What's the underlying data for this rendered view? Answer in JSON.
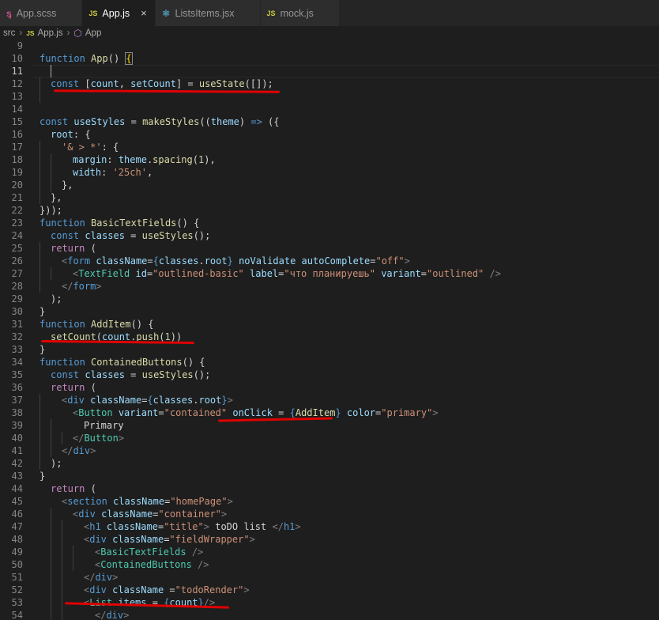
{
  "tabs": [
    {
      "label": "App.scss",
      "icon": "scss-icon",
      "active": false
    },
    {
      "label": "App.js",
      "icon": "js-icon",
      "active": true,
      "close": "×"
    },
    {
      "label": "ListsItems.jsx",
      "icon": "react-icon",
      "active": false
    },
    {
      "label": "mock.js",
      "icon": "js-icon",
      "active": false
    }
  ],
  "breadcrumb": {
    "folder": "src",
    "file": "App.js",
    "symbol": "App",
    "js_badge": "JS"
  },
  "line_numbers": [
    "9",
    "10",
    "11",
    "12",
    "13",
    "14",
    "15",
    "16",
    "17",
    "18",
    "19",
    "20",
    "21",
    "22",
    "23",
    "24",
    "25",
    "26",
    "27",
    "28",
    "29",
    "30",
    "31",
    "32",
    "33",
    "34",
    "35",
    "36",
    "37",
    "38",
    "39",
    "40",
    "41",
    "42",
    "43",
    "44",
    "45",
    "46",
    "47",
    "48",
    "49",
    "50",
    "51",
    "52",
    "53",
    "54"
  ],
  "code": {
    "l10": [
      "function",
      " ",
      "App",
      "() ",
      "{"
    ],
    "l12": [
      "const",
      " [",
      "count",
      ", ",
      "setCount",
      "] = ",
      "useState",
      "([]);"
    ],
    "l15": [
      "const",
      " ",
      "useStyles",
      " = ",
      "makeStyles",
      "((",
      "theme",
      ") ",
      "=>",
      " ({"
    ],
    "l16": [
      "root",
      ": {"
    ],
    "l17": [
      "'& > *'",
      ": {"
    ],
    "l18": [
      "margin",
      ": ",
      "theme",
      ".",
      "spacing",
      "(",
      "1",
      "),"
    ],
    "l19": [
      "width",
      ": ",
      "'25ch'",
      ","
    ],
    "l20": "},",
    "l21": "},",
    "l22": "}));",
    "l23": [
      "function",
      " ",
      "BasicTextFields",
      "() {"
    ],
    "l24": [
      "const",
      " ",
      "classes",
      " = ",
      "useStyles",
      "();"
    ],
    "l25": [
      "return",
      " ("
    ],
    "l26": [
      "<",
      "form",
      " ",
      "className",
      "=",
      "{",
      "classes",
      ".",
      "root",
      "}",
      " ",
      "noValidate",
      " ",
      "autoComplete",
      "=",
      "\"off\"",
      ">"
    ],
    "l27": [
      "<",
      "TextField",
      " ",
      "id",
      "=",
      "\"outlined-basic\"",
      " ",
      "label",
      "=",
      "\"что планируешь\"",
      " ",
      "variant",
      "=",
      "\"outlined\"",
      " />"
    ],
    "l28": [
      "</",
      "form",
      ">"
    ],
    "l29": ");",
    "l30": "}",
    "l31": [
      "function",
      " ",
      "AddItem",
      "() {"
    ],
    "l32": [
      "setCount",
      "(",
      "count",
      ".",
      "push",
      "(",
      "1",
      "))"
    ],
    "l33": "}",
    "l34": [
      "function",
      " ",
      "ContainedButtons",
      "() {"
    ],
    "l35": [
      "const",
      " ",
      "classes",
      " = ",
      "useStyles",
      "();"
    ],
    "l36": [
      "return",
      " ("
    ],
    "l37": [
      "<",
      "div",
      " ",
      "className",
      "=",
      "{",
      "classes",
      ".",
      "root",
      "}",
      ">"
    ],
    "l38": [
      "<",
      "Button",
      " ",
      "variant",
      "=",
      "\"contained\"",
      " ",
      "onClick",
      " = ",
      "{",
      "AddItem",
      "}",
      " ",
      "color",
      "=",
      "\"primary\"",
      ">"
    ],
    "l39": "Primary",
    "l40": [
      "</",
      "Button",
      ">"
    ],
    "l41": [
      "</",
      "div",
      ">"
    ],
    "l42": ");",
    "l43": "}",
    "l44": [
      "return",
      " ("
    ],
    "l45": [
      "<",
      "section",
      " ",
      "className",
      "=",
      "\"homePage\"",
      ">"
    ],
    "l46": [
      "<",
      "div",
      " ",
      "className",
      "=",
      "\"container\"",
      ">"
    ],
    "l47": [
      "<",
      "h1",
      " ",
      "className",
      "=",
      "\"title\"",
      ">",
      " toDO list ",
      "</",
      "h1",
      ">"
    ],
    "l48": [
      "<",
      "div",
      " ",
      "className",
      "=",
      "\"fieldWrapper\"",
      ">"
    ],
    "l49": [
      "<",
      "BasicTextFields",
      " />"
    ],
    "l50": [
      "<",
      "ContainedButtons",
      " />"
    ],
    "l51": [
      "</",
      "div",
      ">"
    ],
    "l52": [
      "<",
      "div",
      " ",
      "className",
      " =",
      "\"todoRender\"",
      ">"
    ],
    "l53": [
      "<",
      "List",
      " ",
      "items",
      " = ",
      "{",
      "count",
      "}",
      "/>"
    ],
    "l54": [
      "</",
      "div",
      ">"
    ]
  },
  "colors": {
    "background": "#1e1e1e",
    "keyword": "#569cd6",
    "function": "#dcdcaa",
    "variable": "#9cdcfe",
    "string": "#ce9178",
    "number": "#b5cea8",
    "component": "#4ec9b0",
    "annotation_underline": "#e00000"
  }
}
